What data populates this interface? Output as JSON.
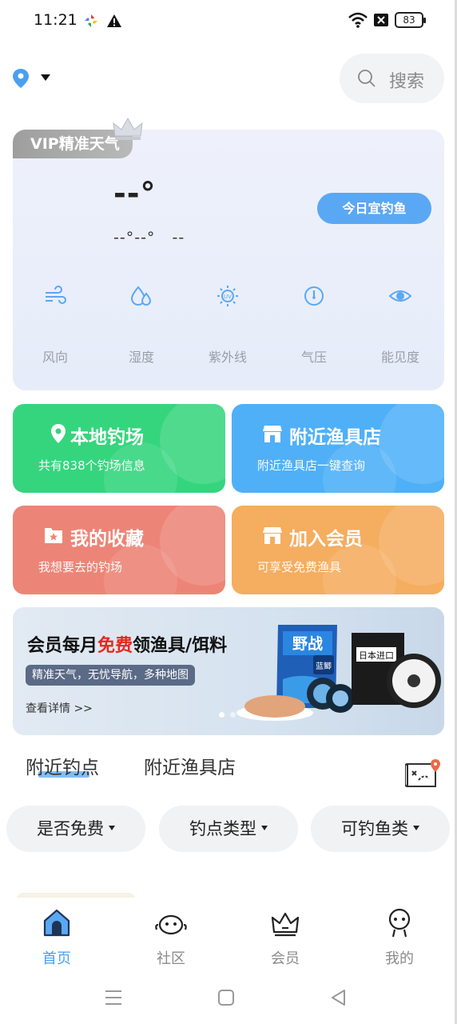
{
  "status_bar": {
    "time": "11:21",
    "battery": "83",
    "icons": [
      "app-icon",
      "warning-icon",
      "wifi-icon",
      "sim-icon",
      "battery-icon"
    ]
  },
  "header": {
    "location_icon": "location-pin-icon",
    "search_label": "搜索",
    "search_icon": "search-icon"
  },
  "weather": {
    "vip_badge": "VIP精准天气",
    "temperature": "--°",
    "temp_range": "--°--°   --",
    "fishing_button": "今日宜钓鱼",
    "items": [
      {
        "label": "风向",
        "icon": "wind-icon"
      },
      {
        "label": "湿度",
        "icon": "humidity-icon"
      },
      {
        "label": "紫外线",
        "icon": "uv-sun-icon"
      },
      {
        "label": "气压",
        "icon": "pressure-gauge-icon"
      },
      {
        "label": "能见度",
        "icon": "eye-icon"
      }
    ]
  },
  "tiles": [
    {
      "title": "本地钓场",
      "subtitle": "共有838个钓场信息",
      "icon": "location-pin-icon",
      "color": "#35d57e"
    },
    {
      "title": "附近渔具店",
      "subtitle": "附近渔具店一键查询",
      "icon": "store-icon",
      "color": "#4fb0f8"
    },
    {
      "title": "我的收藏",
      "subtitle": "我想要去的钓场",
      "icon": "favorite-icon",
      "color": "#ec8577"
    },
    {
      "title": "加入会员",
      "subtitle": "可享受免费渔具",
      "icon": "store-icon",
      "color": "#f5ad60"
    }
  ],
  "banner": {
    "title_before": "会员每月",
    "title_free": "免费",
    "title_after": "领渔具/饵料",
    "tag": "精准天气，无忧导航，多种地图",
    "more": "查看详情 >>",
    "product_texts": [
      "野战",
      "蓝鲫",
      "日本进口"
    ]
  },
  "tabs": [
    "附近钓点",
    "附近渔具店"
  ],
  "filters": [
    "是否免费",
    "钓点类型",
    "可钓鱼类"
  ],
  "bottom_nav": [
    {
      "label": "首页",
      "icon": "home-icon",
      "active": true
    },
    {
      "label": "社区",
      "icon": "community-icon",
      "active": false
    },
    {
      "label": "会员",
      "icon": "crown-icon",
      "active": false
    },
    {
      "label": "我的",
      "icon": "profile-icon",
      "active": false
    }
  ],
  "colors": {
    "accent": "#4a9ff0",
    "fishing_button": "#5aa8f3",
    "free_text": "#e8281c"
  }
}
